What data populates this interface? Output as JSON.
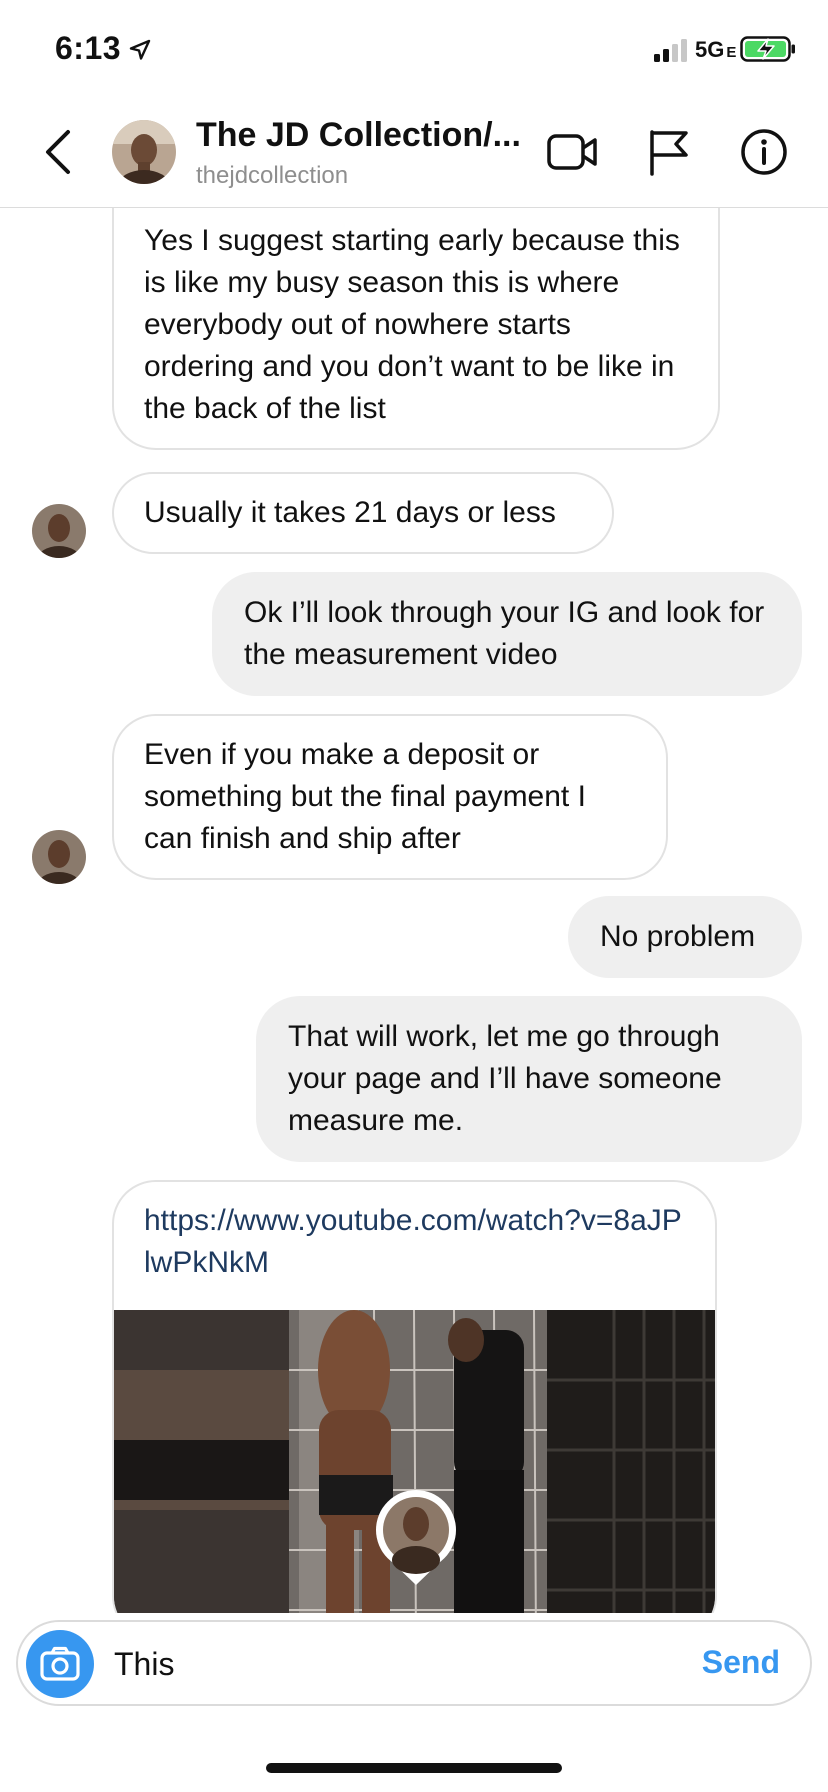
{
  "status_bar": {
    "time": "6:13",
    "network": "5G",
    "network_suffix": "E"
  },
  "header": {
    "title": "The JD Collection/...",
    "subtitle": "thejdcollection",
    "icons": [
      "back-icon",
      "video-call-icon",
      "flag-icon",
      "info-icon"
    ]
  },
  "messages": [
    {
      "direction": "incoming",
      "text": "Yes I suggest starting early because this is like my busy season this is where everybody out of nowhere starts ordering and you don’t want to be like in the back of the list"
    },
    {
      "direction": "incoming",
      "text": "Usually it takes 21 days or less"
    },
    {
      "direction": "outgoing",
      "text": "Ok I’ll look through your IG and look for the measurement video"
    },
    {
      "direction": "incoming",
      "text": "Even if you make a deposit or something but the final payment I can finish and ship after"
    },
    {
      "direction": "outgoing",
      "text": "No problem"
    },
    {
      "direction": "outgoing",
      "text": "That will work, let me go through your page and I’ll have someone measure me."
    },
    {
      "direction": "incoming",
      "type": "link",
      "text": "https://www.youtube.com/watch?v=8aJPlwPkNkM"
    }
  ],
  "composer": {
    "value": "This",
    "send_label": "Send"
  },
  "colors": {
    "accent": "#3797f0",
    "outgoing_bubble": "#efefef",
    "incoming_border": "#e2e2e2",
    "link": "#1e3a5f",
    "battery": "#4cd964"
  }
}
